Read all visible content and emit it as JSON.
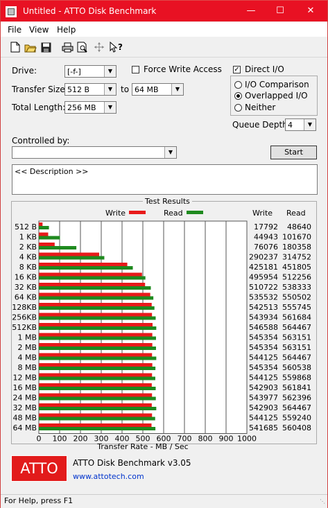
{
  "window": {
    "title": "Untitled - ATTO Disk Benchmark"
  },
  "menu": {
    "items": [
      "File",
      "View",
      "Help"
    ]
  },
  "toolbar": {
    "icons": [
      "new-file-icon",
      "open-folder-icon",
      "save-icon",
      "print-icon",
      "print-preview-icon",
      "move-icon",
      "context-help-icon"
    ]
  },
  "form": {
    "drive_label": "Drive:",
    "drive_value": "[-f-]",
    "force_write_label": "Force Write Access",
    "direct_io_label": "Direct I/O",
    "transfer_size_label": "Transfer Size:",
    "transfer_from": "512 B",
    "to_label": "to",
    "transfer_to": "64 MB",
    "total_length_label": "Total Length:",
    "total_length_value": "256 MB",
    "io_comparison_label": "I/O Comparison",
    "overlapped_io_label": "Overlapped I/O",
    "neither_label": "Neither",
    "queue_depth_label": "Queue Depth:",
    "queue_depth_value": "4",
    "controlled_by_label": "Controlled by:",
    "controlled_by_value": "",
    "start_label": "Start",
    "description_text": "<< Description >>"
  },
  "results": {
    "title": "Test Results",
    "write_header": "Write",
    "read_header": "Read",
    "write_color": "#e81a1a",
    "read_color": "#1f8a1f"
  },
  "chart_data": {
    "type": "bar",
    "orientation": "horizontal",
    "xlabel": "Transfer Rate - MB / Sec",
    "xlim": [
      0,
      1000
    ],
    "xticks": [
      "0",
      "100",
      "200",
      "300",
      "400",
      "500",
      "600",
      "700",
      "800",
      "900",
      "1000"
    ],
    "legend": [
      "Write",
      "Read"
    ],
    "categories": [
      "512 B",
      "1 KB",
      "2 KB",
      "4 KB",
      "8 KB",
      "16 KB",
      "32 KB",
      "64 KB",
      "128KB",
      "256KB",
      "512KB",
      "1 MB",
      "2 MB",
      "4 MB",
      "8 MB",
      "12 MB",
      "16 MB",
      "24 MB",
      "32 MB",
      "48 MB",
      "64 MB"
    ],
    "series": [
      {
        "name": "Write",
        "values": [
          17.8,
          44.9,
          76.1,
          290.2,
          425.2,
          496.0,
          510.7,
          535.5,
          542.5,
          543.9,
          546.6,
          545.4,
          545.4,
          544.1,
          545.4,
          544.1,
          542.9,
          544.0,
          542.9,
          544.1,
          541.7
        ]
      },
      {
        "name": "Read",
        "values": [
          48.6,
          101.7,
          180.4,
          314.8,
          451.8,
          512.3,
          538.3,
          550.5,
          555.7,
          561.7,
          564.5,
          563.2,
          563.2,
          564.5,
          560.5,
          559.9,
          561.8,
          562.4,
          564.5,
          559.2,
          560.4
        ]
      }
    ],
    "write_table": [
      "17792",
      "44943",
      "76076",
      "290237",
      "425181",
      "495954",
      "510722",
      "535532",
      "542513",
      "543934",
      "546588",
      "545354",
      "545354",
      "544125",
      "545354",
      "544125",
      "542903",
      "543977",
      "542903",
      "544125",
      "541685"
    ],
    "read_table": [
      "48640",
      "101670",
      "180358",
      "314752",
      "451805",
      "512256",
      "538333",
      "550502",
      "555745",
      "561684",
      "564467",
      "563151",
      "563151",
      "564467",
      "560538",
      "559868",
      "561841",
      "562396",
      "564467",
      "559240",
      "560408"
    ]
  },
  "footer": {
    "logo": "ATTO",
    "product": "ATTO Disk Benchmark v3.05",
    "link": "www.attotech.com"
  },
  "status": {
    "text": "For Help, press F1"
  }
}
